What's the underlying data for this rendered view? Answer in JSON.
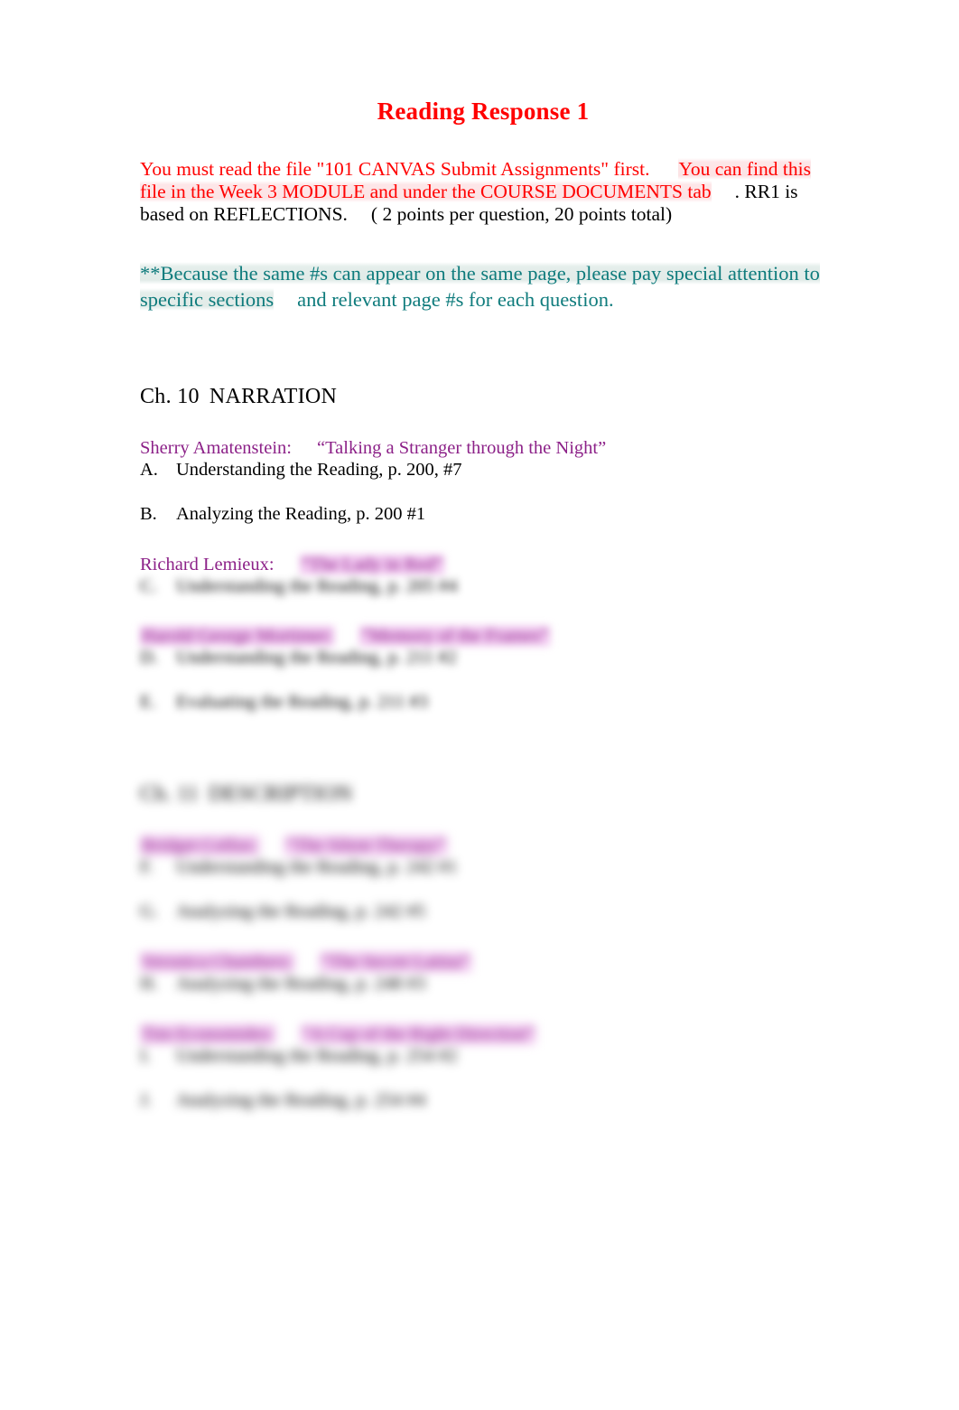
{
  "document": {
    "title": "Reading Response 1",
    "title_color": "#ff0000"
  },
  "intro": {
    "red_paragraph": {
      "segment_1": "You must read the file \"101 CANVAS Submit Assignments\" first.",
      "segment_2": "You can find this file in the Week 3 MODULE and under the COURSE DOCUMENTS tab",
      "segment_3": ". RR1 is based on REFLECTIONS.",
      "segment_4": "( 2 points per question, 20 points total)",
      "color": "#ff0000"
    },
    "teal_paragraph": {
      "segment_1": "**Because the same #s can appear on the same page, please pay special attention to specific sections",
      "segment_2": "and relevant page #s for each question.",
      "color": "#0e7b7c"
    }
  },
  "chapters": [
    {
      "number": "Ch. 10",
      "name": "NARRATION",
      "readings": [
        {
          "author": "Sherry Amatenstein:",
          "author_color": "#8c2188",
          "title": "“Talking a Stranger through the Night”",
          "redacted": false,
          "highlighted": false,
          "questions": [
            {
              "label": "A.",
              "text": "Understanding the Reading, p. 200, #7",
              "redacted": false
            },
            {
              "label": "B.",
              "text": "Analyzing the Reading, p. 200 #1",
              "redacted": false
            }
          ]
        },
        {
          "author": "Richard Lemieux:",
          "author_color": "#8c2188",
          "title": "“The Lady in Red”",
          "redacted": true,
          "highlighted": true,
          "questions": [
            {
              "label": "C.",
              "text": "Understanding the Reading, p. 205 #4",
              "redacted": true
            }
          ]
        },
        {
          "author": "Harold George Mortimer:",
          "author_color": "#8c2188",
          "title": "“Memory of the Frames”",
          "redacted": true,
          "highlighted": true,
          "questions": [
            {
              "label": "D.",
              "text": "Understanding the Reading, p. 211 #2",
              "redacted": true
            },
            {
              "label": "E.",
              "text": "Evaluating the Reading, p. 211 #3",
              "redacted": true
            }
          ]
        }
      ]
    },
    {
      "number": "Ch. 11",
      "name": "DESCRIPTION",
      "redacted": true,
      "readings": [
        {
          "author": "Bridget Colfax:",
          "author_color": "#8c2188",
          "title": "“The Silent Therapy”",
          "redacted": true,
          "highlighted": true,
          "questions": [
            {
              "label": "F.",
              "text": "Understanding the Reading, p. 242 #1",
              "redacted": true
            },
            {
              "label": "G.",
              "text": "Analyzing the Reading, p. 242 #5",
              "redacted": true
            }
          ]
        },
        {
          "author": "Veronica Chambers:",
          "author_color": "#8c2188",
          "title": "“The Secret Latina”",
          "redacted": true,
          "highlighted": true,
          "questions": [
            {
              "label": "H.",
              "text": "Analyzing the Reading, p. 248 #3",
              "redacted": true
            }
          ]
        },
        {
          "author": "Tim Economides:",
          "author_color": "#8c2188",
          "title": "“A Cup of the Right Direction”",
          "redacted": true,
          "highlighted": true,
          "questions": [
            {
              "label": "I.",
              "text": "Understanding the Reading, p. 254 #2",
              "redacted": true
            },
            {
              "label": "J.",
              "text": "Analyzing the Reading, p. 254 #4",
              "redacted": true
            }
          ]
        }
      ]
    }
  ]
}
